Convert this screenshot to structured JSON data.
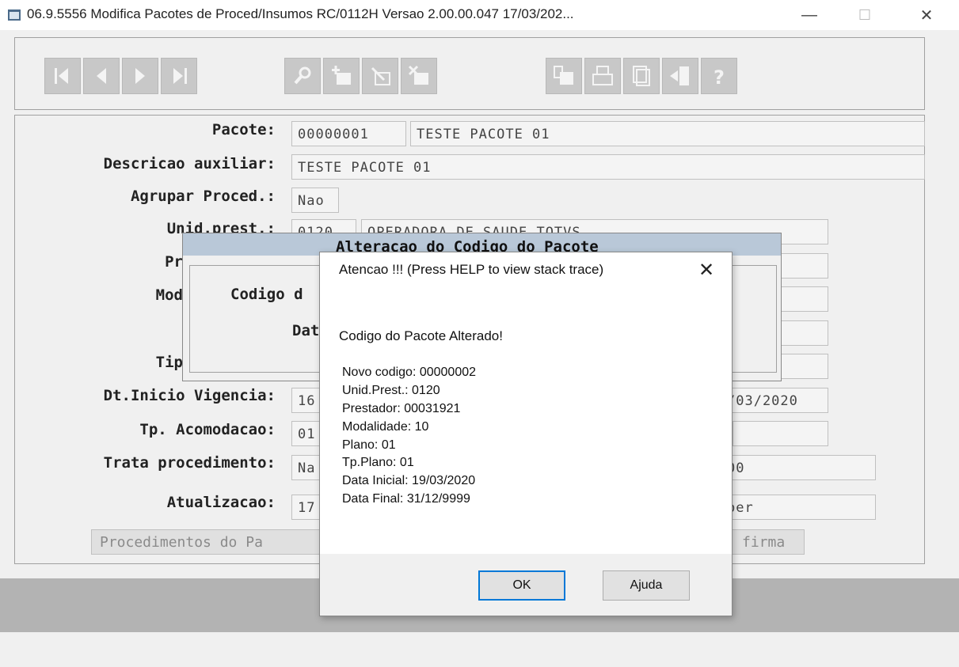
{
  "window": {
    "title": "06.9.5556  Modifica  Pacotes de Proced/Insumos RC/0112H Versao 2.00.00.047 17/03/202...",
    "minimize": "—",
    "maximize": "☐",
    "close": "✕"
  },
  "toolbar": {
    "buttons": [
      "first-icon",
      "previous-icon",
      "next-icon",
      "last-icon",
      "search-icon",
      "add-icon",
      "edit-icon",
      "delete-icon",
      "filter-icon",
      "print-icon",
      "copy-icon",
      "exit-icon",
      "help-icon"
    ]
  },
  "form": {
    "pacote_label": "Pacote:",
    "pacote_code": "00000001",
    "pacote_desc": "TESTE PACOTE 01",
    "desc_aux_label": "Descricao auxiliar:",
    "desc_aux_value": "TESTE PACOTE 01",
    "agrupar_label": "Agrupar Proced.:",
    "agrupar_value": "Nao",
    "unid_label": "Unid.prest.:",
    "unid_code": "0120",
    "unid_name": "OPERADORA DE SAUDE TOTVS",
    "prestador_label": "Pr",
    "modalidade_label": "Mod",
    "tipo_label": "Tip",
    "dt_inicio_label": "Dt.Inicio Vigencia:",
    "dt_inicio_value": "16",
    "dt_fim_value": "/03/2020",
    "acomodacao_label": "Tp. Acomodacao:",
    "acomodacao_value": "01",
    "trata_label": "Trata procedimento:",
    "trata_value": "Na",
    "trata_right": "00",
    "atualizacao_label": "Atualizacao:",
    "atualizacao_value": "17",
    "atualizacao_right": "per",
    "procedimentos_button": "Procedimentos do Pa",
    "confirma_button": "firma"
  },
  "dialog2": {
    "title": "Alteracao do Codigo do Pacote",
    "codigo_label": "Codigo d",
    "data_label": "Dat"
  },
  "msgbox": {
    "title": "Atencao !!!  (Press HELP to view stack trace)",
    "close": "✕",
    "heading": "Codigo do Pacote Alterado!",
    "lines": [
      "Novo codigo:  00000002",
      "Unid.Prest.:  0120",
      "Prestador:  00031921",
      "Modalidade:  10",
      "Plano:  01",
      "Tp.Plano:  01",
      "Data Inicial:  19/03/2020",
      "Data Final:  31/12/9999"
    ],
    "ok_label": "OK",
    "help_label": "Ajuda"
  }
}
